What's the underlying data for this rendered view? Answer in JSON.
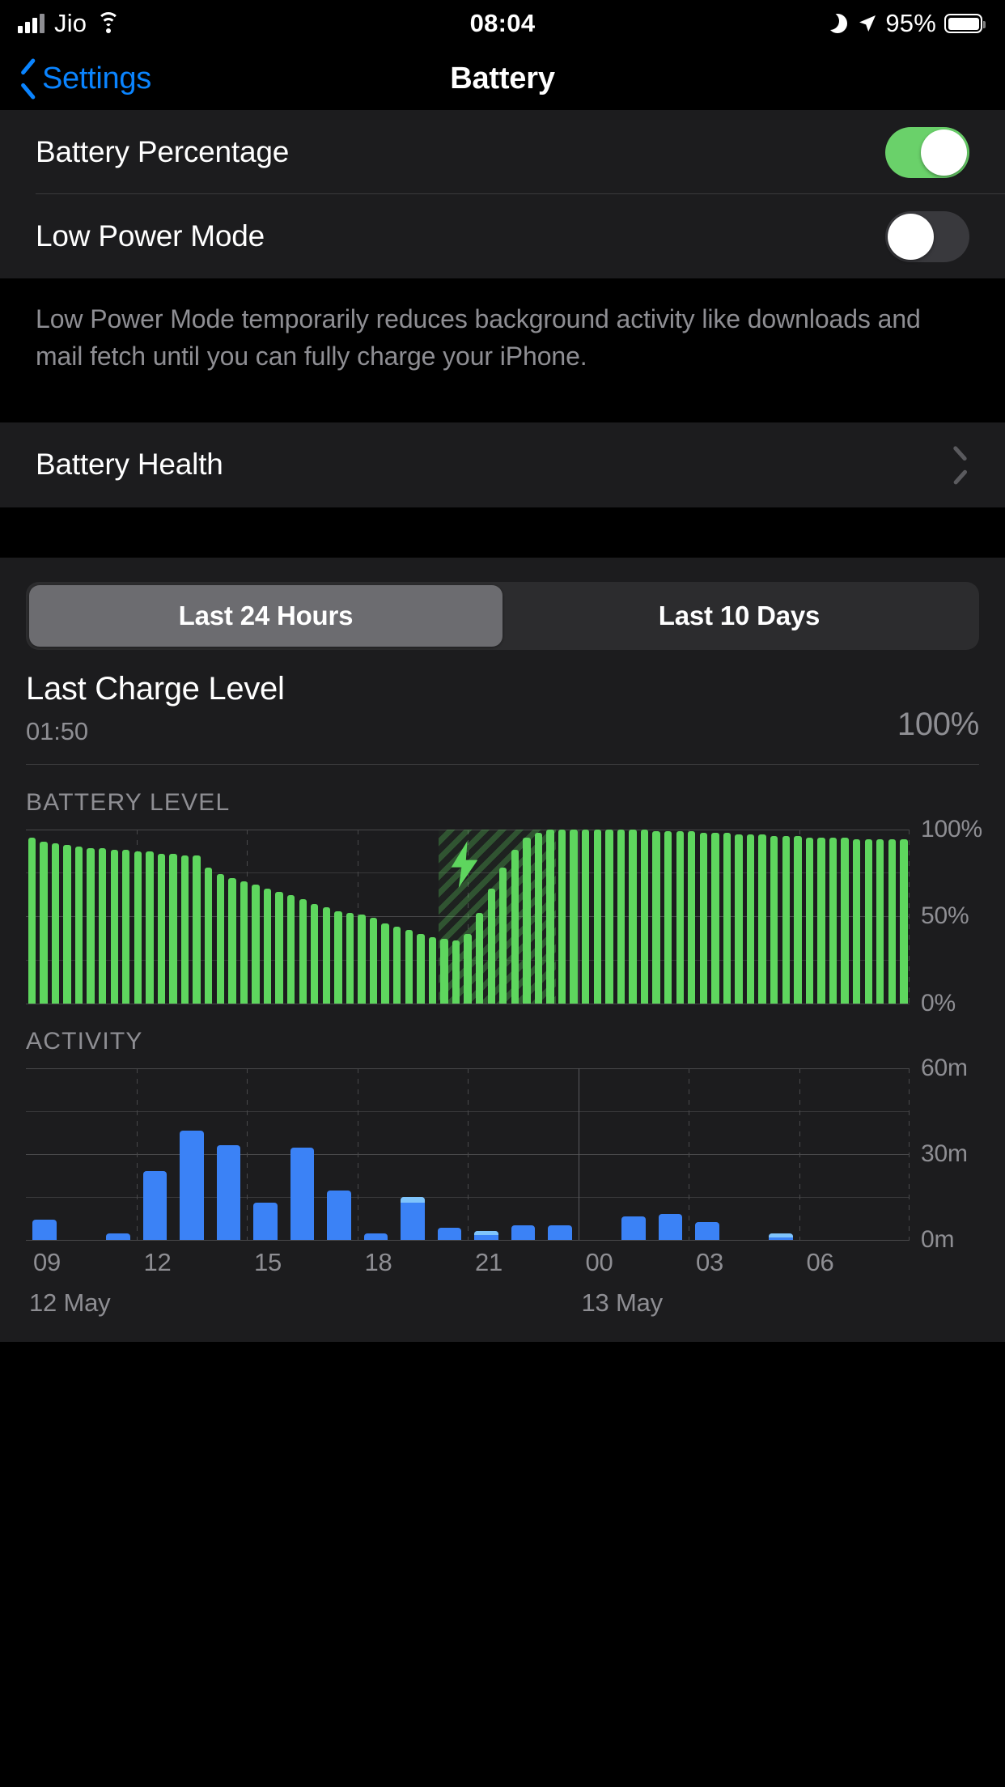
{
  "status_bar": {
    "carrier": "Jio",
    "time": "08:04",
    "battery_percent": "95%",
    "icons": [
      "signal-bars-icon",
      "wifi-icon",
      "moon-icon",
      "location-arrow-icon",
      "battery-icon"
    ]
  },
  "nav": {
    "back_label": "Settings",
    "title": "Battery"
  },
  "settings": {
    "battery_percentage_label": "Battery Percentage",
    "battery_percentage_on": true,
    "low_power_mode_label": "Low Power Mode",
    "low_power_mode_on": false,
    "low_power_footnote": "Low Power Mode temporarily reduces background activity like downloads and mail fetch until you can fully charge your iPhone.",
    "battery_health_label": "Battery Health"
  },
  "usage": {
    "segments": [
      "Last 24 Hours",
      "Last 10 Days"
    ],
    "selected_segment": 0,
    "last_charge_title": "Last Charge Level",
    "last_charge_time": "01:50",
    "last_charge_value": "100%"
  },
  "colors": {
    "accent_blue": "#0a84ff",
    "toggle_green": "#6ad16a",
    "battery_green": "#5ed65e",
    "activity_blue": "#3b82f6",
    "activity_light_blue": "#7fc4fb",
    "group_bg": "#1c1c1e",
    "page_bg": "#000000",
    "secondary_text": "#8e8e93"
  },
  "chart_data": [
    {
      "type": "bar",
      "title": "BATTERY LEVEL",
      "ylabel": "",
      "xlabel": "",
      "ylim": [
        0,
        100
      ],
      "ytick_labels": [
        "100%",
        "50%",
        "0%"
      ],
      "ytick_values": [
        100,
        50,
        0
      ],
      "grid": true,
      "x_start_hour": 8,
      "charge_band": {
        "start_index": 35,
        "end_index": 44,
        "label": "charging-bolt-icon"
      },
      "values": [
        95,
        93,
        92,
        91,
        90,
        89,
        89,
        88,
        88,
        87,
        87,
        86,
        86,
        85,
        85,
        78,
        74,
        72,
        70,
        68,
        66,
        64,
        62,
        60,
        57,
        55,
        53,
        52,
        51,
        49,
        46,
        44,
        42,
        40,
        38,
        37,
        36,
        40,
        52,
        66,
        78,
        88,
        95,
        98,
        100,
        100,
        100,
        100,
        100,
        100,
        100,
        100,
        100,
        99,
        99,
        99,
        99,
        98,
        98,
        98,
        97,
        97,
        97,
        96,
        96,
        96,
        95,
        95,
        95,
        95,
        94,
        94,
        94,
        94,
        94
      ]
    },
    {
      "type": "bar",
      "title": "ACTIVITY",
      "ylabel": "",
      "xlabel": "",
      "ylim": [
        0,
        60
      ],
      "ytick_labels": [
        "60m",
        "30m",
        "0m"
      ],
      "ytick_values": [
        60,
        30,
        0
      ],
      "grid": true,
      "unit": "minutes",
      "series": [
        {
          "name": "screen-off",
          "values": [
            7,
            0,
            2,
            24,
            38,
            33,
            13,
            32,
            17,
            2,
            13,
            4,
            2,
            5,
            5,
            0,
            8,
            9,
            6,
            0,
            1,
            0,
            0,
            0
          ]
        },
        {
          "name": "screen-on",
          "values": [
            0,
            0,
            0,
            0,
            0,
            0,
            0,
            0,
            0,
            0,
            2,
            0,
            1,
            0,
            0,
            0,
            0,
            0,
            0,
            0,
            1,
            0,
            0,
            0
          ]
        }
      ],
      "xtick_labels": [
        "09",
        "12",
        "15",
        "18",
        "21",
        "00",
        "03",
        "06"
      ],
      "day_labels": [
        {
          "text": "12 May",
          "position": 0
        },
        {
          "text": "13 May",
          "position": 5
        }
      ]
    }
  ]
}
